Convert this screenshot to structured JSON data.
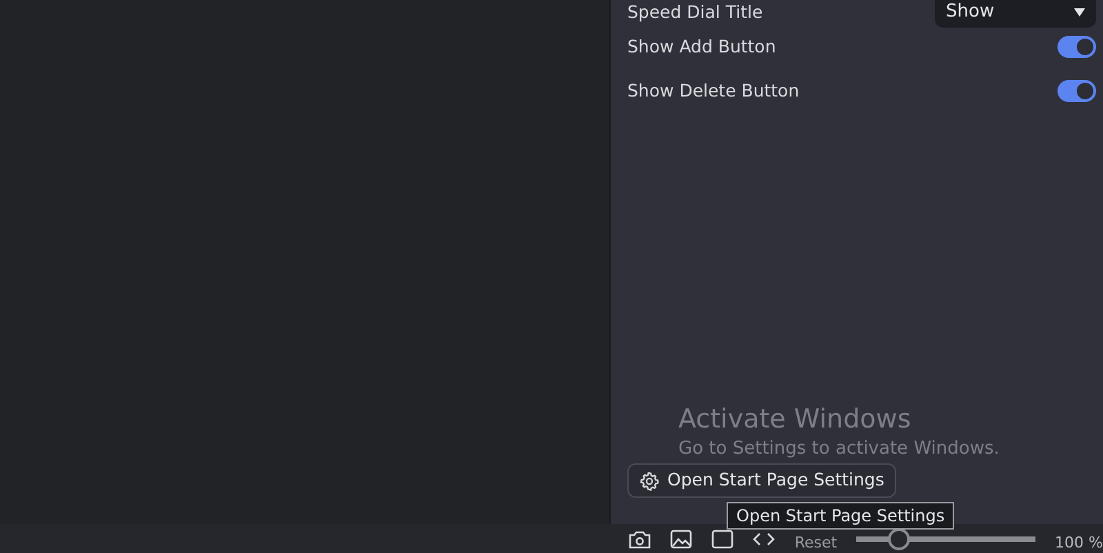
{
  "settings_panel": {
    "rows": [
      {
        "kind": "select",
        "label": "Speed Dial Title",
        "value": "Show"
      },
      {
        "kind": "toggle",
        "label": "Show Add Button",
        "on": true
      },
      {
        "kind": "toggle",
        "label": "Show Delete Button",
        "on": true
      }
    ],
    "settings_button": {
      "label": "Open Start Page Settings"
    }
  },
  "os_notice": {
    "title": "Activate Windows",
    "message": "Go to Settings to activate Windows."
  },
  "status_bar": {
    "reset": "Reset",
    "zoom": {
      "level": 0.2,
      "reading": "100 %"
    }
  },
  "tooltip": "Open Start Page Settings"
}
